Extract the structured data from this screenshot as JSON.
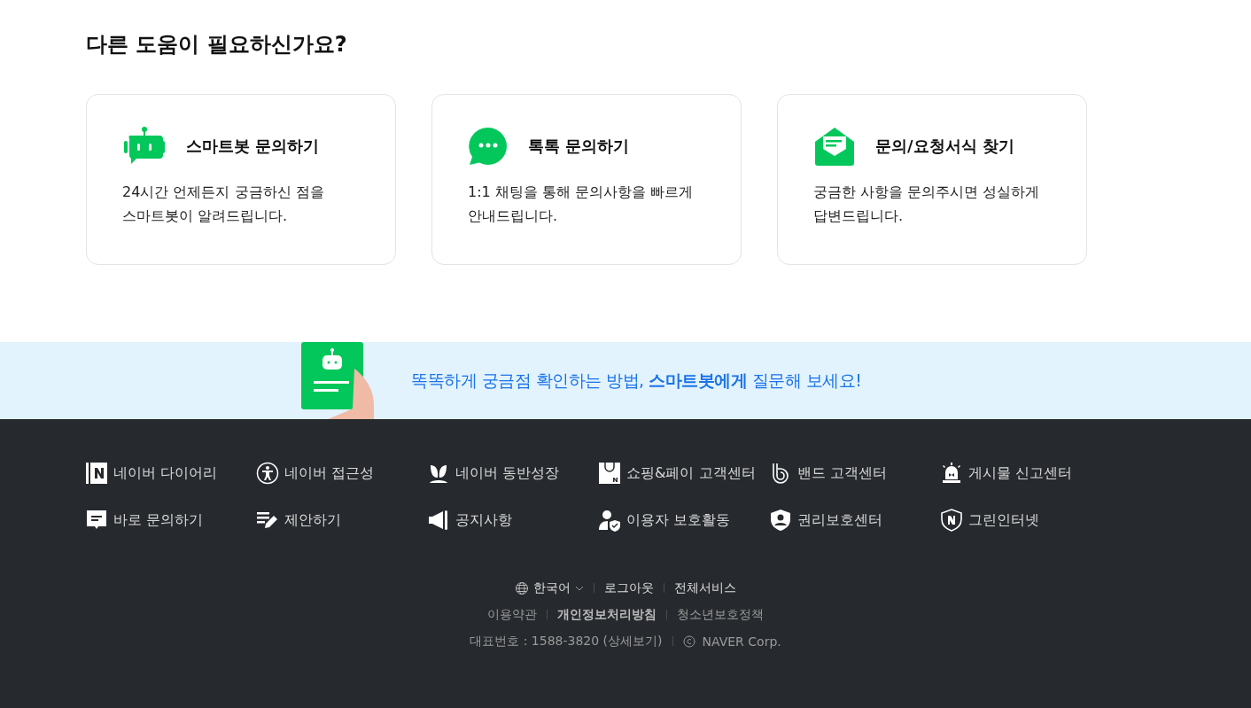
{
  "heading": "다른 도움이 필요하신가요?",
  "cards": [
    {
      "kind": "robot",
      "title": "스마트봇 문의하기",
      "description": "24시간 언제든지 궁금하신 점을 스마트봇이 알려드립니다."
    },
    {
      "kind": "chat",
      "title": "톡톡 문의하기",
      "description": "1:1 채팅을 통해 문의사항을 빠르게 안내드립니다."
    },
    {
      "kind": "envelope",
      "title": "문의/요청서식 찾기",
      "description": "궁금한 사항을 문의주시면 성실하게 답변드립니다."
    }
  ],
  "banner": {
    "text": "똑똑하게 궁금점  확인하는 방법, **스마트봇에게** 질문해 보세요!"
  },
  "footer_links": [
    {
      "kind": "diary",
      "label": "네이버 다이어리"
    },
    {
      "kind": "accessibility",
      "label": "네이버 접근성"
    },
    {
      "kind": "sprout",
      "label": "네이버 동반성장"
    },
    {
      "kind": "bag",
      "label": "쇼핑&페이 고객센터"
    },
    {
      "kind": "band",
      "label": "밴드 고객센터"
    },
    {
      "kind": "siren",
      "label": "게시물 신고센터"
    },
    {
      "kind": "message",
      "label": "바로 문의하기"
    },
    {
      "kind": "pen",
      "label": "제안하기"
    },
    {
      "kind": "megaphone",
      "label": "공지사항"
    },
    {
      "kind": "user-shield",
      "label": "이용자 보호활동"
    },
    {
      "kind": "shield",
      "label": "권리보호센터"
    },
    {
      "kind": "badge",
      "label": "그린인터넷"
    }
  ],
  "language": "한국어",
  "top_links": [
    {
      "label": "로그아웃",
      "bold": false
    },
    {
      "label": "전체서비스",
      "bold": false
    }
  ],
  "policy_links": [
    {
      "label": "이용약관",
      "bold": false
    },
    {
      "label": "개인정보처리방침",
      "bold": true
    },
    {
      "label": "청소년보호정책",
      "bold": false
    }
  ],
  "phone": "대표번호 : 1588-3820 (상세보기)",
  "copyright": "NAVER Corp."
}
